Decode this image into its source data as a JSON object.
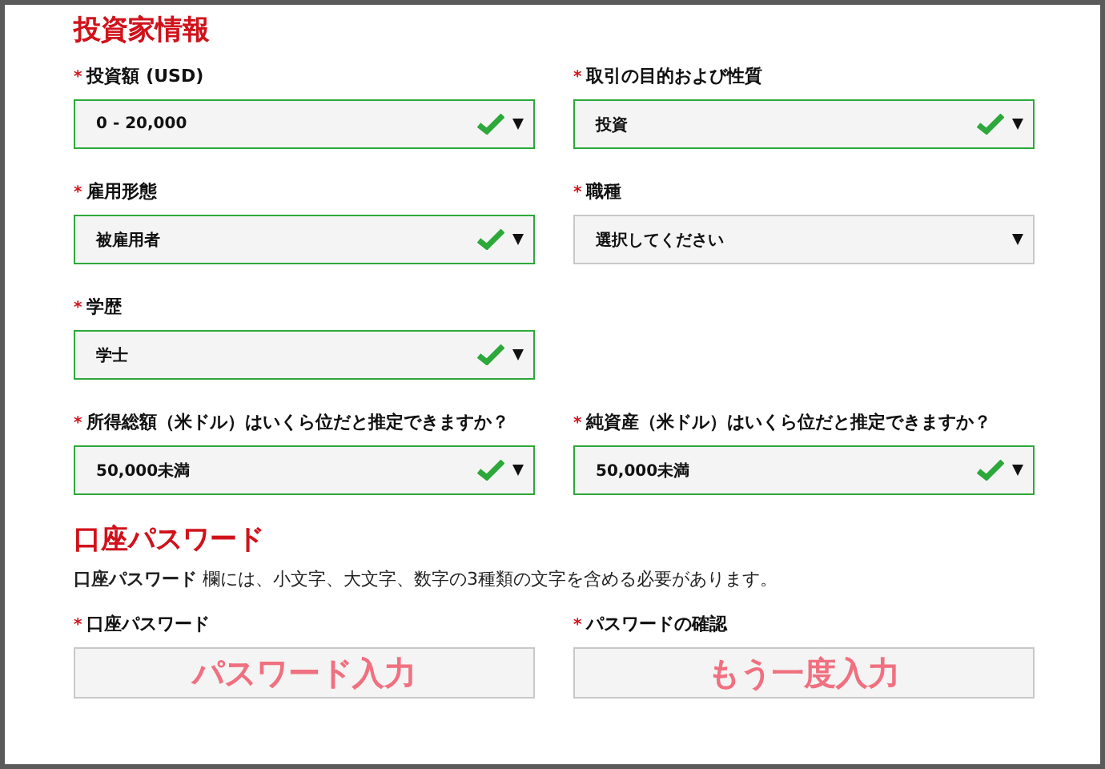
{
  "investor_section": {
    "title": "投資家情報",
    "rows": [
      [
        {
          "mark": "*",
          "label": "投資額 (USD)",
          "value": "0 - 20,000",
          "valid": true
        },
        {
          "mark": "*",
          "label": "取引の目的および性質",
          "value": "投資",
          "valid": true
        }
      ],
      [
        {
          "mark": "*",
          "label": "雇用形態",
          "value": "被雇用者",
          "valid": true
        },
        {
          "mark": "*",
          "label": "職種",
          "value": "選択してください",
          "valid": false
        }
      ],
      [
        {
          "mark": "*",
          "label": "学歴",
          "value": "学士",
          "valid": true
        }
      ],
      [
        {
          "mark": "*",
          "label": "所得総額（米ドル）はいくら位だと推定できますか？",
          "value": "50,000未満",
          "valid": true
        },
        {
          "mark": "*",
          "label": "純資産（米ドル）はいくら位だと推定できますか？",
          "value": "50,000未満",
          "valid": true
        }
      ]
    ]
  },
  "password_section": {
    "title": "口座パスワード",
    "note": "**口座パスワード** 欄には、小文字、大文字、数字の3種類の文字を含める必要があります。",
    "fields": [
      {
        "mark": "*",
        "label": "口座パスワード",
        "placeholder": "パスワード入力"
      },
      {
        "mark": "*",
        "label": "パスワードの確認",
        "placeholder": "もう一度入力"
      }
    ]
  }
}
